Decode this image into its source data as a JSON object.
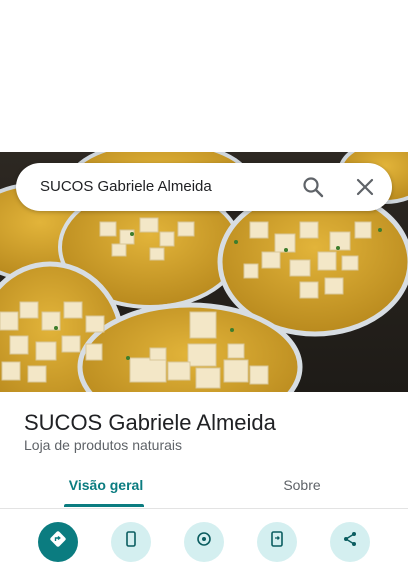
{
  "search": {
    "query": "SUCOS Gabriele Almeida",
    "search_icon": "search-icon",
    "close_icon": "close-icon"
  },
  "place": {
    "name": "SUCOS Gabriele Almeida",
    "category": "Loja de produtos naturais"
  },
  "tabs": [
    {
      "label": "Visão geral",
      "selected": true
    },
    {
      "label": "Sobre",
      "selected": false
    }
  ],
  "actions": [
    {
      "icon": "directions-icon"
    },
    {
      "icon": "phone-icon"
    },
    {
      "icon": "location-icon"
    },
    {
      "icon": "send-to-phone-icon"
    },
    {
      "icon": "share-icon"
    }
  ],
  "colors": {
    "accent": "#0b7c80",
    "accent_light": "#d4eff0",
    "title": "#202124",
    "secondary_text": "#5f6368"
  }
}
